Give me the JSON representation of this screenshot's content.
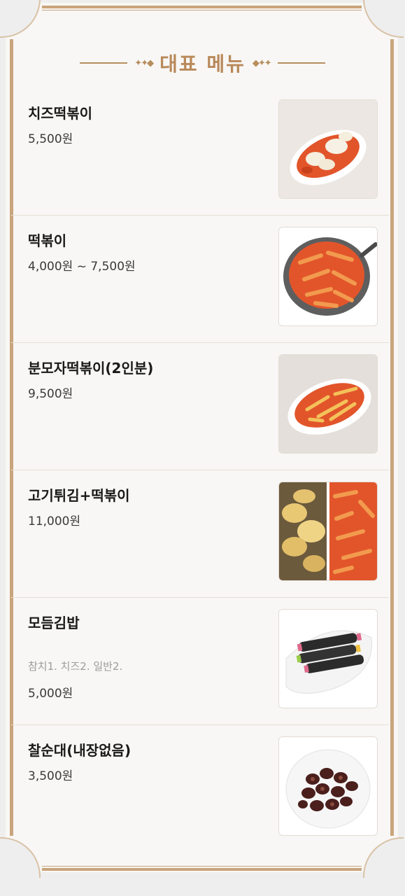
{
  "header": {
    "title": "대표 메뉴"
  },
  "menu": [
    {
      "name": "치즈떡볶이",
      "price": "5,500원",
      "image_icon": "cheese-tteokbokki-photo"
    },
    {
      "name": "떡볶이",
      "price": "4,000원 ~ 7,500원",
      "image_icon": "tteokbokki-photo"
    },
    {
      "name": "분모자떡볶이(2인분)",
      "price": "9,500원",
      "image_icon": "bunmoja-tteokbokki-photo"
    },
    {
      "name": "고기튀김+떡볶이",
      "price": "11,000원",
      "image_icon": "fried-meat-tteokbokki-photo"
    },
    {
      "name": "모듬김밥",
      "desc": "참치1. 치즈2. 일반2.",
      "price": "5,000원",
      "image_icon": "gimbap-photo"
    },
    {
      "name": "찰순대(내장없음)",
      "price": "3,500원",
      "image_icon": "sundae-photo"
    }
  ],
  "colors": {
    "frame": "#c9a47c",
    "title": "#b9895a",
    "sauce": "#e2552b"
  }
}
